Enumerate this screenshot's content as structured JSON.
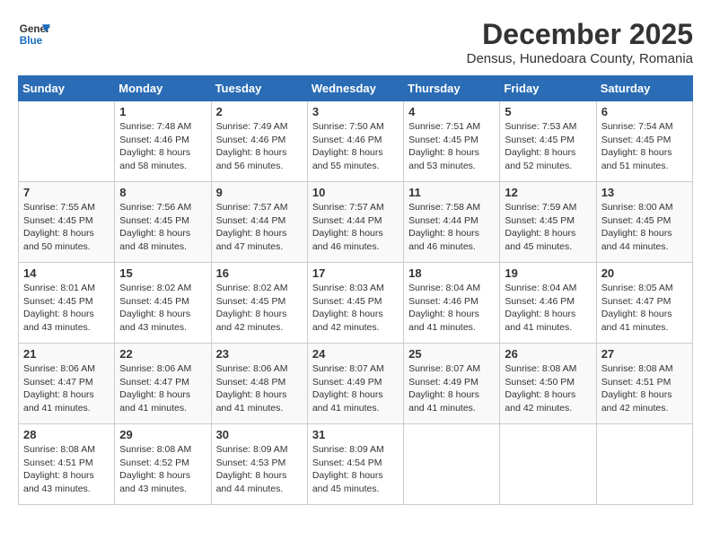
{
  "logo": {
    "line1": "General",
    "line2": "Blue"
  },
  "title": "December 2025",
  "subtitle": "Densus, Hunedoara County, Romania",
  "days_of_week": [
    "Sunday",
    "Monday",
    "Tuesday",
    "Wednesday",
    "Thursday",
    "Friday",
    "Saturday"
  ],
  "weeks": [
    [
      {
        "day": "",
        "info": ""
      },
      {
        "day": "1",
        "info": "Sunrise: 7:48 AM\nSunset: 4:46 PM\nDaylight: 8 hours\nand 58 minutes."
      },
      {
        "day": "2",
        "info": "Sunrise: 7:49 AM\nSunset: 4:46 PM\nDaylight: 8 hours\nand 56 minutes."
      },
      {
        "day": "3",
        "info": "Sunrise: 7:50 AM\nSunset: 4:46 PM\nDaylight: 8 hours\nand 55 minutes."
      },
      {
        "day": "4",
        "info": "Sunrise: 7:51 AM\nSunset: 4:45 PM\nDaylight: 8 hours\nand 53 minutes."
      },
      {
        "day": "5",
        "info": "Sunrise: 7:53 AM\nSunset: 4:45 PM\nDaylight: 8 hours\nand 52 minutes."
      },
      {
        "day": "6",
        "info": "Sunrise: 7:54 AM\nSunset: 4:45 PM\nDaylight: 8 hours\nand 51 minutes."
      }
    ],
    [
      {
        "day": "7",
        "info": "Sunrise: 7:55 AM\nSunset: 4:45 PM\nDaylight: 8 hours\nand 50 minutes."
      },
      {
        "day": "8",
        "info": "Sunrise: 7:56 AM\nSunset: 4:45 PM\nDaylight: 8 hours\nand 48 minutes."
      },
      {
        "day": "9",
        "info": "Sunrise: 7:57 AM\nSunset: 4:44 PM\nDaylight: 8 hours\nand 47 minutes."
      },
      {
        "day": "10",
        "info": "Sunrise: 7:57 AM\nSunset: 4:44 PM\nDaylight: 8 hours\nand 46 minutes."
      },
      {
        "day": "11",
        "info": "Sunrise: 7:58 AM\nSunset: 4:44 PM\nDaylight: 8 hours\nand 46 minutes."
      },
      {
        "day": "12",
        "info": "Sunrise: 7:59 AM\nSunset: 4:45 PM\nDaylight: 8 hours\nand 45 minutes."
      },
      {
        "day": "13",
        "info": "Sunrise: 8:00 AM\nSunset: 4:45 PM\nDaylight: 8 hours\nand 44 minutes."
      }
    ],
    [
      {
        "day": "14",
        "info": "Sunrise: 8:01 AM\nSunset: 4:45 PM\nDaylight: 8 hours\nand 43 minutes."
      },
      {
        "day": "15",
        "info": "Sunrise: 8:02 AM\nSunset: 4:45 PM\nDaylight: 8 hours\nand 43 minutes."
      },
      {
        "day": "16",
        "info": "Sunrise: 8:02 AM\nSunset: 4:45 PM\nDaylight: 8 hours\nand 42 minutes."
      },
      {
        "day": "17",
        "info": "Sunrise: 8:03 AM\nSunset: 4:45 PM\nDaylight: 8 hours\nand 42 minutes."
      },
      {
        "day": "18",
        "info": "Sunrise: 8:04 AM\nSunset: 4:46 PM\nDaylight: 8 hours\nand 41 minutes."
      },
      {
        "day": "19",
        "info": "Sunrise: 8:04 AM\nSunset: 4:46 PM\nDaylight: 8 hours\nand 41 minutes."
      },
      {
        "day": "20",
        "info": "Sunrise: 8:05 AM\nSunset: 4:47 PM\nDaylight: 8 hours\nand 41 minutes."
      }
    ],
    [
      {
        "day": "21",
        "info": "Sunrise: 8:06 AM\nSunset: 4:47 PM\nDaylight: 8 hours\nand 41 minutes."
      },
      {
        "day": "22",
        "info": "Sunrise: 8:06 AM\nSunset: 4:47 PM\nDaylight: 8 hours\nand 41 minutes."
      },
      {
        "day": "23",
        "info": "Sunrise: 8:06 AM\nSunset: 4:48 PM\nDaylight: 8 hours\nand 41 minutes."
      },
      {
        "day": "24",
        "info": "Sunrise: 8:07 AM\nSunset: 4:49 PM\nDaylight: 8 hours\nand 41 minutes."
      },
      {
        "day": "25",
        "info": "Sunrise: 8:07 AM\nSunset: 4:49 PM\nDaylight: 8 hours\nand 41 minutes."
      },
      {
        "day": "26",
        "info": "Sunrise: 8:08 AM\nSunset: 4:50 PM\nDaylight: 8 hours\nand 42 minutes."
      },
      {
        "day": "27",
        "info": "Sunrise: 8:08 AM\nSunset: 4:51 PM\nDaylight: 8 hours\nand 42 minutes."
      }
    ],
    [
      {
        "day": "28",
        "info": "Sunrise: 8:08 AM\nSunset: 4:51 PM\nDaylight: 8 hours\nand 43 minutes."
      },
      {
        "day": "29",
        "info": "Sunrise: 8:08 AM\nSunset: 4:52 PM\nDaylight: 8 hours\nand 43 minutes."
      },
      {
        "day": "30",
        "info": "Sunrise: 8:09 AM\nSunset: 4:53 PM\nDaylight: 8 hours\nand 44 minutes."
      },
      {
        "day": "31",
        "info": "Sunrise: 8:09 AM\nSunset: 4:54 PM\nDaylight: 8 hours\nand 45 minutes."
      },
      {
        "day": "",
        "info": ""
      },
      {
        "day": "",
        "info": ""
      },
      {
        "day": "",
        "info": ""
      }
    ]
  ]
}
